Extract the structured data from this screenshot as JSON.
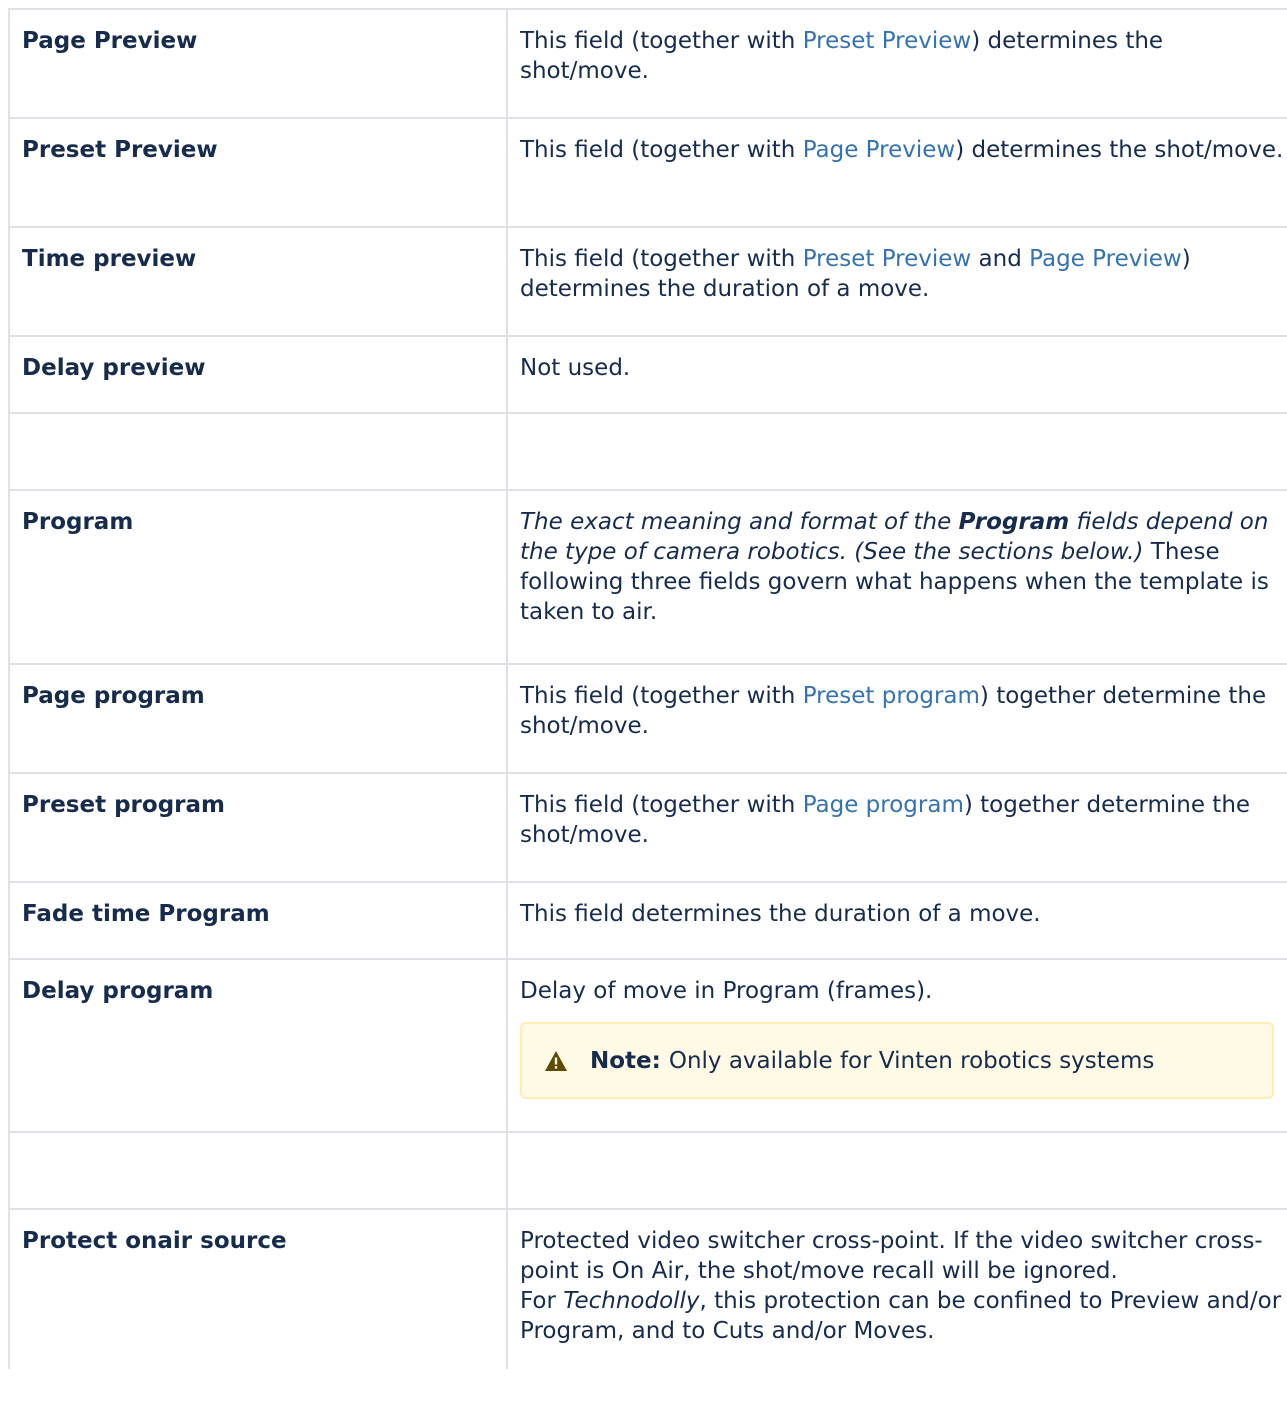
{
  "rows": [
    {
      "field": "Page Preview",
      "desc": [
        {
          "t": "This field (together with "
        },
        {
          "t": "Preset Preview",
          "link": true
        },
        {
          "t": ") determines the shot/move."
        }
      ]
    },
    {
      "field": "Preset Preview",
      "desc": [
        {
          "t": "This field (together with "
        },
        {
          "t": "Page Preview",
          "link": true
        },
        {
          "t": ") determines the shot/move."
        }
      ]
    },
    {
      "field": "Time preview",
      "desc": [
        {
          "t": "This field (together with "
        },
        {
          "t": "Preset Preview",
          "link": true
        },
        {
          "t": " and "
        },
        {
          "t": "Page Preview",
          "link": true
        },
        {
          "t": ") determines the duration of a move."
        }
      ]
    },
    {
      "field": "Delay preview",
      "desc": [
        {
          "t": "Not used."
        }
      ]
    },
    {
      "field": "",
      "desc": []
    },
    {
      "field": "Program",
      "desc": [
        {
          "t": "The exact meaning and format of the ",
          "italic": true
        },
        {
          "t": "Program",
          "italic": true,
          "bold": true
        },
        {
          "t": "  fields depend on the type of camera robotics. (See the sections below.)",
          "italic": true
        },
        {
          "t": " These following three fields govern what happens when the template is taken to air."
        }
      ]
    },
    {
      "field": "Page program",
      "desc": [
        {
          "t": "This field (together with "
        },
        {
          "t": "Preset program",
          "link": true
        },
        {
          "t": ") together determine the shot/move."
        }
      ]
    },
    {
      "field": "Preset program",
      "desc": [
        {
          "t": "This field (together with "
        },
        {
          "t": "Page program",
          "link": true
        },
        {
          "t": ") together determine the shot/move."
        }
      ]
    },
    {
      "field": "Fade time Program",
      "desc": [
        {
          "t": "This field determines the duration of a move."
        }
      ]
    },
    {
      "field": "Delay program",
      "desc": [
        {
          "t": "Delay of move in Program (frames)."
        }
      ],
      "note": {
        "label": "Note:",
        "text": "Only available for Vinten robotics systems",
        "icon": "warning-icon"
      }
    },
    {
      "field": "",
      "desc": []
    },
    {
      "field": "Protect onair source",
      "desc": [
        {
          "t": "Protected video switcher cross-point. If the video switcher cross-point is On Air, the shot/move recall will be ignored."
        },
        {
          "br": true
        },
        {
          "t": "For "
        },
        {
          "t": "Technodolly",
          "italic": true
        },
        {
          "t": ", this protection can be confined to Preview and/or Program, and to Cuts and/or Moves."
        }
      ]
    }
  ],
  "colors": {
    "link": "#3572b0",
    "border": "#dfe1e6",
    "note_bg": "#fffae6",
    "note_border": "#ffedb3",
    "icon": "#5e4b00"
  }
}
